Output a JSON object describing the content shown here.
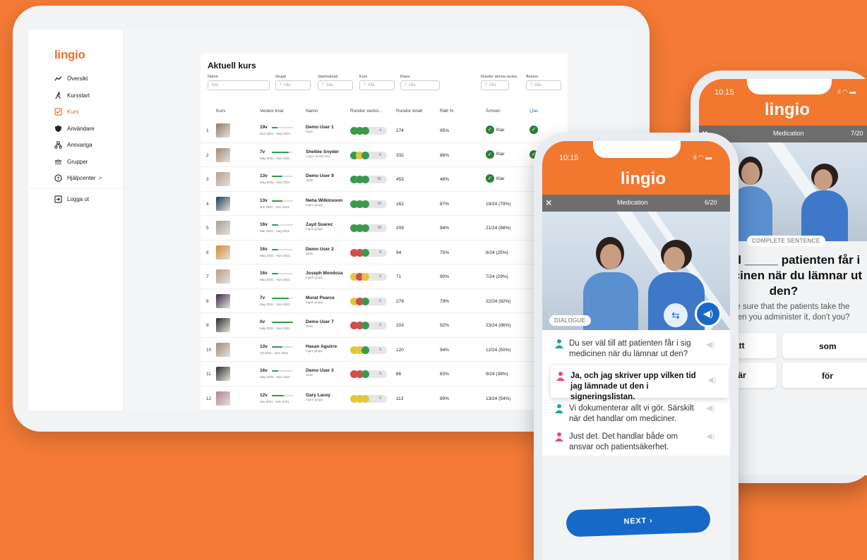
{
  "brand": "lingio",
  "tablet": {
    "nav": [
      {
        "label": "Översikt",
        "icon": "trend-icon"
      },
      {
        "label": "Kursstart",
        "icon": "runner-icon"
      },
      {
        "label": "Kurs",
        "icon": "checkbox-icon",
        "active": true
      },
      {
        "label": "Användare",
        "icon": "shield-icon"
      },
      {
        "label": "Ansvariga",
        "icon": "hierarchy-icon"
      },
      {
        "label": "Grupper",
        "icon": "group-icon"
      },
      {
        "label": "Hjälpcenter",
        "icon": "help-icon"
      },
      {
        "label": "Logga ut",
        "icon": "logout-icon"
      }
    ],
    "title": "Aktuell kurs",
    "filters": [
      {
        "label": "Namn",
        "value": "Sök"
      },
      {
        "label": "Grupp",
        "value": "Alla"
      },
      {
        "label": "Startmånad",
        "value": "Alla"
      },
      {
        "label": "Kurs",
        "value": "Alla"
      },
      {
        "label": "Klass",
        "value": "Alla"
      },
      {
        "label": "Rundor denna vecka",
        "value": "Alla"
      },
      {
        "label": "Ämnen",
        "value": "Alla"
      }
    ],
    "columns": [
      "Kurs",
      "Veckor kvar",
      "Namn",
      "Rundor vecko...",
      "Rundor totalt",
      "Rätt %",
      "Ämnen",
      "I fas"
    ],
    "rows": [
      {
        "idx": "1",
        "weeks": "19v",
        "progress": 0.25,
        "dates": "Nov 2021 - May 2022",
        "name": "Demo User 1",
        "group": "Stats",
        "dots": [
          "g",
          "g",
          "g"
        ],
        "week_rounds": "4",
        "total": "274",
        "pct": "95%",
        "amnen": "Klar",
        "done": true,
        "ifas": true,
        "thumb": "#8c7a6b"
      },
      {
        "idx": "2",
        "weeks": "7v",
        "progress": 0.8,
        "dates": "May 2021 - Nov 2021",
        "name": "Shelbie Snyder",
        "group": "Lingio Stockholm",
        "dots": [
          "g",
          "y",
          "g"
        ],
        "week_rounds": "6",
        "total": "332",
        "pct": "86%",
        "amnen": "Klar",
        "done": true,
        "ifas": true,
        "thumb": "#a08978"
      },
      {
        "idx": "3",
        "weeks": "13v",
        "progress": 0.5,
        "dates": "May 2021 - Nov 2021",
        "name": "Demo User 9",
        "group": "Stats",
        "dots": [
          "g",
          "g",
          "g"
        ],
        "week_rounds": "55",
        "total": "453",
        "pct": "48%",
        "amnen": "Klar",
        "done": true,
        "ifas": false,
        "thumb": "#b29c8e"
      },
      {
        "idx": "4",
        "weeks": "13v",
        "progress": 0.5,
        "dates": "Jun 2021 - Nov 2021",
        "name": "Neha Wilkinsoon",
        "group": "Ingen grupp",
        "dots": [
          "g",
          "g",
          "g"
        ],
        "week_rounds": "16",
        "total": "162",
        "pct": "87%",
        "amnen": "19/24 (79%)",
        "done": false,
        "ifas": false,
        "thumb": "#1d3a5c"
      },
      {
        "idx": "5",
        "weeks": "16v",
        "progress": 0.3,
        "dates": "Mar 2021 - Aug 2021",
        "name": "Zayd Suarez",
        "group": "Ingen grupp",
        "dots": [
          "g",
          "g",
          "g"
        ],
        "week_rounds": "18",
        "total": "209",
        "pct": "94%",
        "amnen": "21/24 (88%)",
        "done": false,
        "ifas": false,
        "thumb": "#a49c9a"
      },
      {
        "idx": "6",
        "weeks": "16v",
        "progress": 0.3,
        "dates": "May 2021 - Nov 2021",
        "name": "Demo User 2",
        "group": "Stats",
        "dots": [
          "r",
          "r",
          "g"
        ],
        "week_rounds": "8",
        "total": "94",
        "pct": "75%",
        "amnen": "6/24 (25%)",
        "done": false,
        "ifas": false,
        "thumb": "#d58a2a"
      },
      {
        "idx": "7",
        "weeks": "16v",
        "progress": 0.3,
        "dates": "May 2021 - Nov 2021",
        "name": "Joseph Mendoza",
        "group": "Ingen grupp",
        "dots": [
          "y",
          "r",
          "y"
        ],
        "week_rounds": "0",
        "total": "71",
        "pct": "90%",
        "amnen": "7/24 (29%)",
        "done": false,
        "ifas": false,
        "thumb": "#b59c8a"
      },
      {
        "idx": "8",
        "weeks": "7v",
        "progress": 0.8,
        "dates": "May 2021 - Nov 2021",
        "name": "Murat Pearce",
        "group": "Ingen grupp",
        "dots": [
          "y",
          "r",
          "g"
        ],
        "week_rounds": "5",
        "total": "279",
        "pct": "79%",
        "amnen": "22/24 (92%)",
        "done": false,
        "ifas": false,
        "thumb": "#3a2a4a"
      },
      {
        "idx": "9",
        "weeks": "0v",
        "progress": 1.0,
        "dates": "May 2021 - Nov 2021",
        "name": "Demo User 7",
        "group": "Stats",
        "dots": [
          "r",
          "r",
          "g"
        ],
        "week_rounds": "0",
        "total": "203",
        "pct": "92%",
        "amnen": "23/24 (96%)",
        "done": false,
        "ifas": false,
        "thumb": "#2a2a2a"
      },
      {
        "idx": "10",
        "weeks": "13v",
        "progress": 0.5,
        "dates": "Jul 2021 - Dec 2021",
        "name": "Hasan Aguirre",
        "group": "Ingen grupp",
        "dots": [
          "y",
          "y",
          "g"
        ],
        "week_rounds": "9",
        "total": "120",
        "pct": "94%",
        "amnen": "12/24 (50%)",
        "done": false,
        "ifas": false,
        "thumb": "#9a8a80"
      },
      {
        "idx": "11",
        "weeks": "16v",
        "progress": 0.3,
        "dates": "May 2021 - Nov 2021",
        "name": "Demo User 3",
        "group": "Stats",
        "dots": [
          "r",
          "r",
          "g"
        ],
        "week_rounds": "9",
        "total": "86",
        "pct": "83%",
        "amnen": "9/24 (38%)",
        "done": false,
        "ifas": false,
        "thumb": "#2c2c2c"
      },
      {
        "idx": "12",
        "weeks": "12v",
        "progress": 0.55,
        "dates": "Jun 2021 - Nov 2021",
        "name": "Gary Lacey",
        "group": "Ingen grupp",
        "dots": [
          "y",
          "y",
          "y"
        ],
        "week_rounds": "0",
        "total": "113",
        "pct": "89%",
        "amnen": "13/24 (54%)",
        "done": false,
        "ifas": false,
        "thumb": "#b08090"
      }
    ]
  },
  "phone_front": {
    "time": "10:15",
    "topic": "Medication",
    "progress_label": "6/20",
    "chip": "DIALOGUE",
    "lines": [
      {
        "speaker": "teal",
        "text": "Du ser väl till att patienten får i sig medicinen när du lämnar ut den?",
        "highlight": false
      },
      {
        "speaker": "pink",
        "text": "Ja, och jag skriver upp vilken tid jag lämnade ut den i signeringslistan.",
        "highlight": true
      },
      {
        "speaker": "teal",
        "text": "Vi dokumenterar allt vi gör. Särskilt när det handlar om mediciner.",
        "highlight": false
      },
      {
        "speaker": "pink",
        "text": "Just det. Det handlar både om ansvar och patientsäkerhet.",
        "highlight": false
      }
    ],
    "next": "NEXT"
  },
  "phone_back": {
    "time": "10:15",
    "topic": "Medication",
    "progress_label": "7/20",
    "chip": "COMPLETE SENTENCE",
    "question_l1": "väl till _____ patienten får i",
    "question_l2": "medicinen när du lämnar ut",
    "question_l3": "den?",
    "translation_l1": "make sure that the patients take the",
    "translation_l2": "e when you administer it, don't you?",
    "options": [
      "att",
      "som",
      "när",
      "för"
    ]
  },
  "colors": {
    "orange": "#F47A36",
    "green": "#2e7d3a",
    "blue": "#1669c8"
  }
}
